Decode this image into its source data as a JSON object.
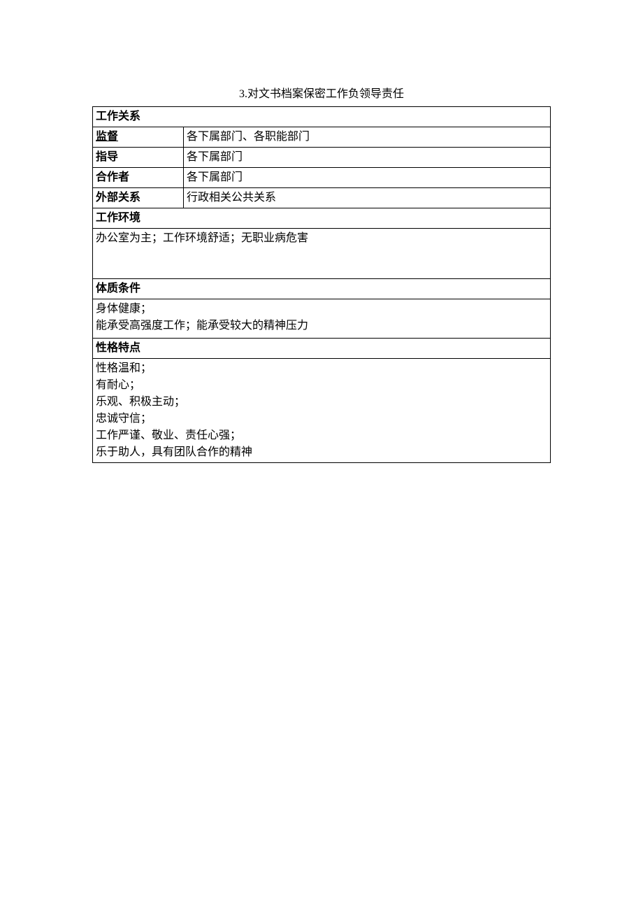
{
  "header": {
    "line": "3.对文书档案保密工作负领导责任"
  },
  "sections": {
    "work_relations": {
      "title": "工作关系",
      "rows": [
        {
          "label": "监督",
          "value": "各下属部门、各职能部门"
        },
        {
          "label": "指导",
          "value": "各下属部门"
        },
        {
          "label": "合作者",
          "value": "各下属部门"
        },
        {
          "label": "外部关系",
          "value": "行政相关公共关系"
        }
      ]
    },
    "work_environment": {
      "title": "工作环境",
      "content": "办公室为主；工作环境舒适；无职业病危害"
    },
    "physical_conditions": {
      "title": "体质条件",
      "content": "身体健康；\n能承受高强度工作；能承受较大的精神压力"
    },
    "personality": {
      "title": "性格特点",
      "content": "性格温和；\n有耐心；\n乐观、积极主动；\n忠诚守信；\n工作严谨、敬业、责任心强；\n乐于助人，具有团队合作的精神"
    }
  }
}
